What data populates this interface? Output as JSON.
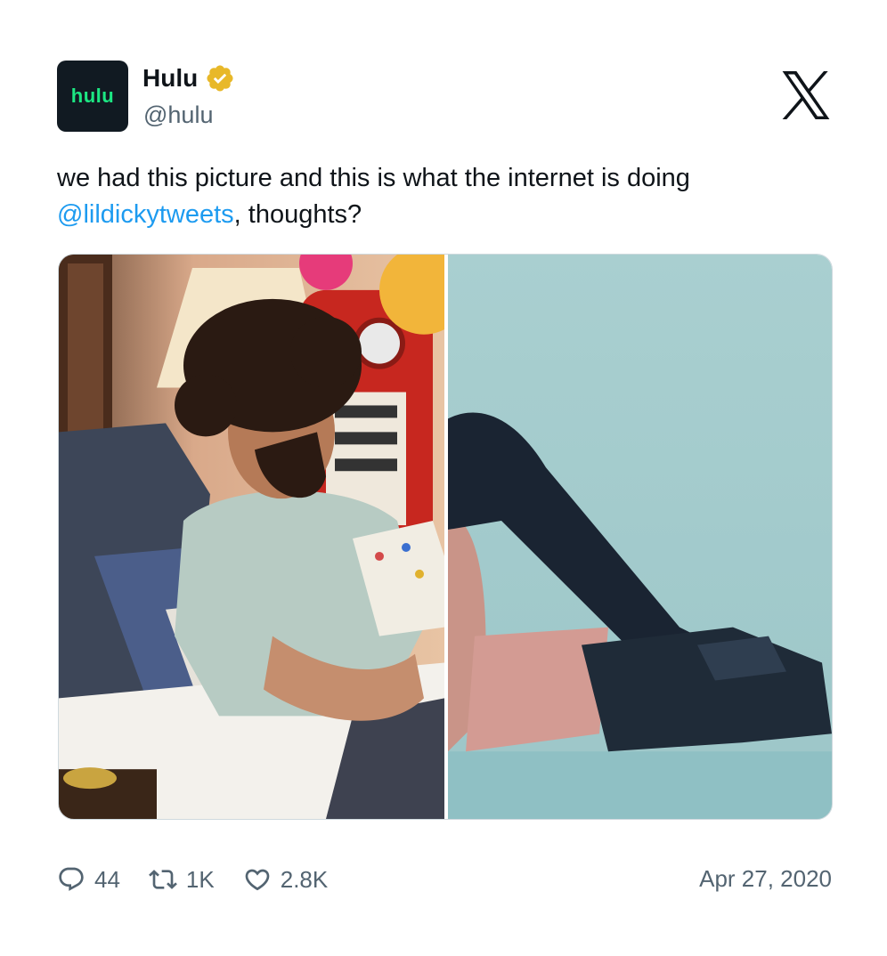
{
  "tweet": {
    "avatar_text": "hulu",
    "display_name": "Hulu",
    "handle": "@hulu",
    "text_before": "we had this picture and this is what the internet is doing",
    "mention": "@lildickytweets",
    "text_after": ", thoughts?",
    "date": "Apr 27, 2020"
  },
  "stats": {
    "replies": "44",
    "retweets": "1K",
    "likes": "2.8K"
  },
  "colors": {
    "brand_green": "#1ce783",
    "link_blue": "#1d9bf0",
    "muted_gray": "#536471",
    "verified_gold": "#e8b829"
  },
  "icons": {
    "verified": "verified-badge-icon",
    "platform": "x-logo-icon",
    "reply": "reply-icon",
    "retweet": "retweet-icon",
    "like": "heart-icon"
  },
  "media": {
    "left": "man-in-bed-reading-photo",
    "right": "legs-in-black-boots-photo"
  }
}
